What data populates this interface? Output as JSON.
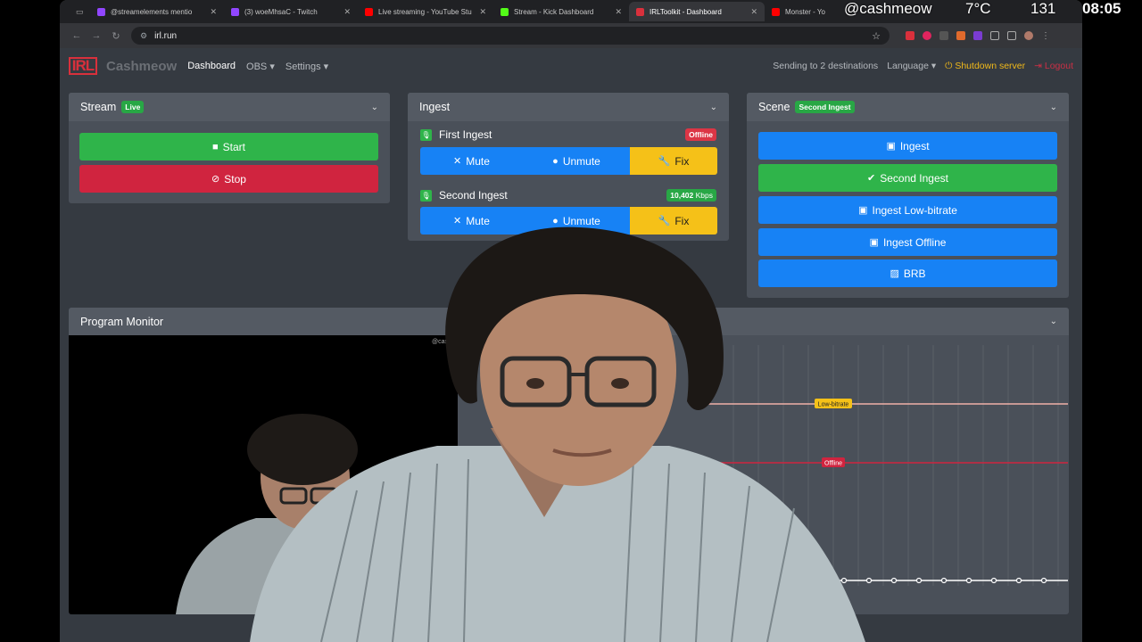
{
  "overlay": {
    "username": "@cashmeow",
    "temperature": "7°C",
    "count": "131",
    "time": "08:05"
  },
  "browser": {
    "tabs": [
      {
        "title": "@streamelements mentio",
        "color": "#9146ff"
      },
      {
        "title": "(3) woeMhsaC - Twitch",
        "color": "#9146ff"
      },
      {
        "title": "Live streaming - YouTube Stu",
        "color": "#ff0000"
      },
      {
        "title": "Stream - Kick Dashboard",
        "color": "#53fc18"
      },
      {
        "title": "IRLToolkit - Dashboard",
        "color": "#d9303c"
      },
      {
        "title": "Monster - Yo",
        "color": "#ff0000"
      }
    ],
    "url": "irl.run"
  },
  "navbar": {
    "brand_logo": "IRL",
    "brand": "Cashmeow",
    "links": [
      "Dashboard",
      "OBS",
      "Settings"
    ],
    "destinations": "Sending to 2 destinations",
    "language": "Language",
    "shutdown": "Shutdown server",
    "logout": "Logout"
  },
  "stream_card": {
    "title": "Stream",
    "status": "Live",
    "start_label": "Start",
    "stop_label": "Stop"
  },
  "ingest_card": {
    "title": "Ingest",
    "ingests": [
      {
        "name": "First Ingest",
        "status": "Offline",
        "mute": "Mute",
        "unmute": "Unmute",
        "fix": "Fix"
      },
      {
        "name": "Second Ingest",
        "status": "10,402",
        "status_unit": "Kbps",
        "mute": "Mute",
        "unmute": "Unmute",
        "fix": "Fix"
      }
    ]
  },
  "scene_card": {
    "title": "Scene",
    "active": "Second Ingest",
    "scenes": [
      "Ingest",
      "Second Ingest",
      "Ingest Low-bitrate",
      "Ingest Offline",
      "BRB"
    ]
  },
  "monitor": {
    "title": "Program Monitor",
    "watermark": "@cashm",
    "graph_lines": [
      "Low-bitrate",
      "Offline"
    ]
  },
  "colors": {
    "green": "#2fb44a",
    "red": "#d0243f",
    "blue": "#1782f5",
    "yellow": "#f5c118"
  }
}
